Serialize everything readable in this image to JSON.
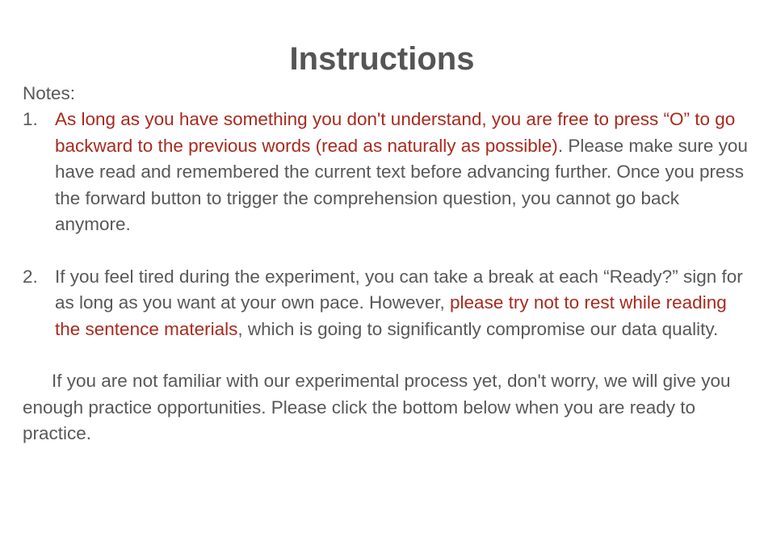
{
  "title": "Instructions",
  "notes_label": "Notes:",
  "items": [
    {
      "number": "1.",
      "highlight": "As long as you have something you don't understand, you are free to press “O” to go backward to the previous words (read as naturally as possible)",
      "rest": ". Please make sure you have read and remembered the current text before advancing further. Once you press the forward button to trigger the comprehension question, you cannot go back anymore."
    },
    {
      "number": "2.",
      "before": "If you feel tired during the experiment, you can take a break at each “Ready?” sign for as long as you want at your own pace. However, ",
      "highlight": "please try not to rest while reading the sentence materials",
      "after": ", which is going to significantly compromise our data quality."
    }
  ],
  "closing": "If you are not familiar with our experimental process yet, don't worry, we will give you enough practice opportunities. Please click the bottom below when you are ready to practice.",
  "colors": {
    "text": "#585858",
    "title": "#555555",
    "highlight": "#a82a1e",
    "background": "#ffffff"
  }
}
